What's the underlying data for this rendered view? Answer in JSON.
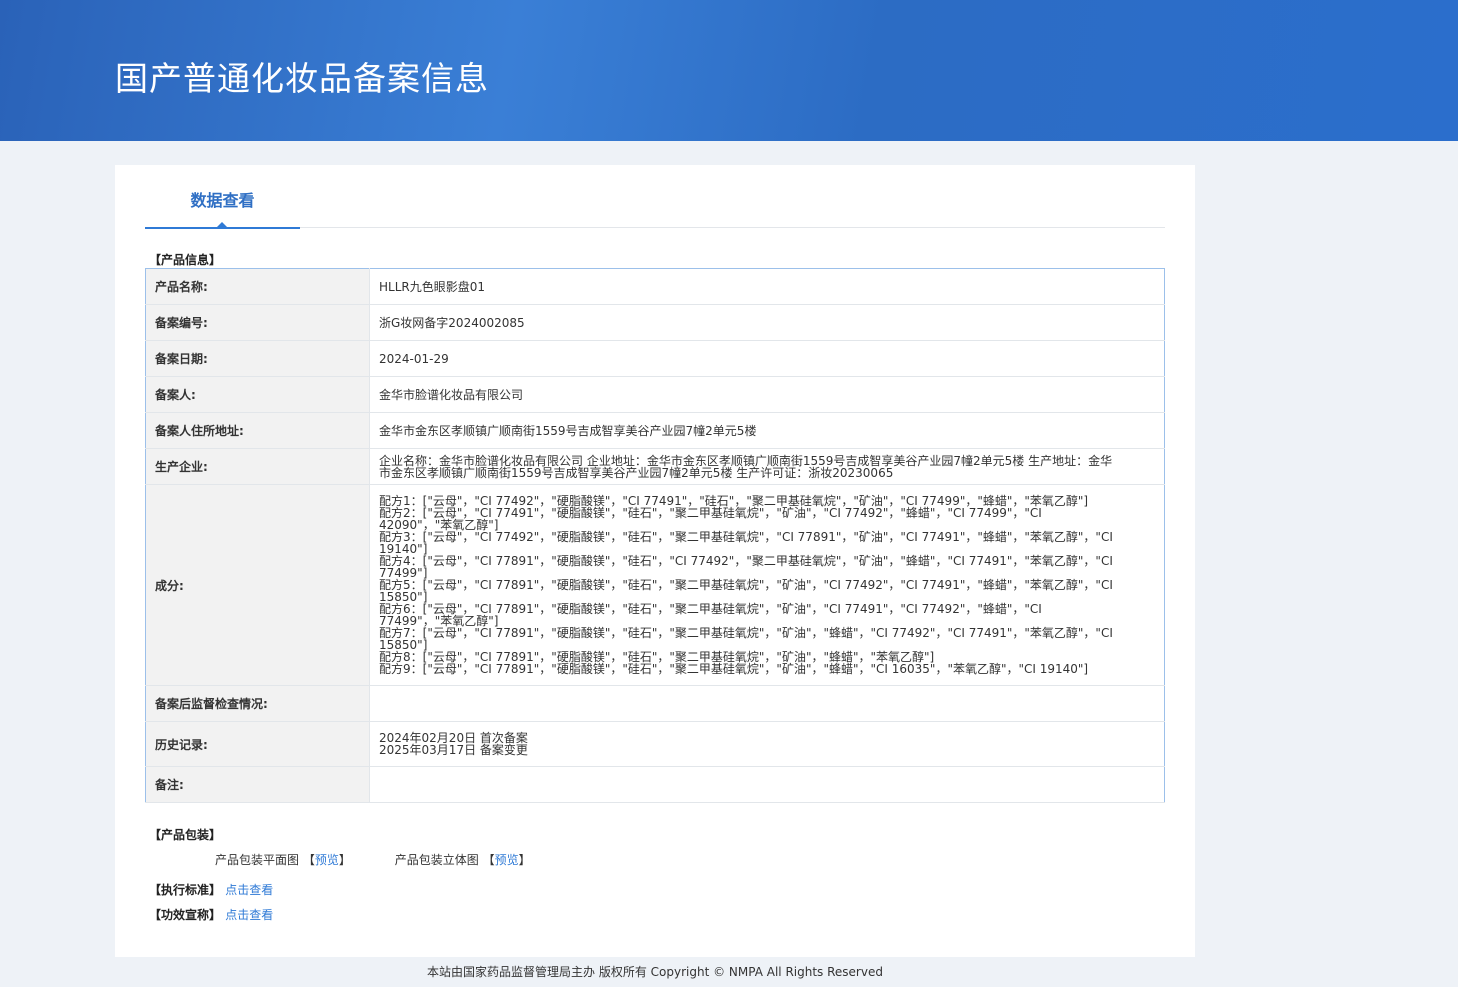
{
  "header": {
    "title": "国产普通化妆品备案信息"
  },
  "tab": "数据查看",
  "section_product": "【产品信息】",
  "rows": [
    {
      "k": "产品名称:",
      "v": "HLLR九色眼影盘01"
    },
    {
      "k": "备案编号:",
      "v": "浙G妆网备字2024002085"
    },
    {
      "k": "备案日期:",
      "v": "2024-01-29"
    },
    {
      "k": "备案人:",
      "v": "金华市脸谱化妆品有限公司"
    },
    {
      "k": "备案人住所地址:",
      "v": "金华市金东区孝顺镇广顺南街1559号吉成智享美谷产业园7幢2单元5楼"
    },
    {
      "k": "生产企业:",
      "v": "企业名称：金华市脸谱化妆品有限公司 企业地址：金华市金东区孝顺镇广顺南街1559号吉成智享美谷产业园7幢2单元5楼 生产地址：金华市金东区孝顺镇广顺南街1559号吉成智享美谷产业园7幢2单元5楼 生产许可证：浙妆20230065"
    }
  ],
  "ingredients": {
    "k": "成分:",
    "lines": [
      "配方1：[\"云母\"，\"CI 77492\"，\"硬脂酸镁\"，\"CI 77491\"，\"硅石\"，\"聚二甲基硅氧烷\"，\"矿油\"，\"CI 77499\"，\"蜂蜡\"，\"苯氧乙醇\"]",
      "配方2：[\"云母\"，\"CI 77491\"，\"硬脂酸镁\"，\"硅石\"，\"聚二甲基硅氧烷\"，\"矿油\"，\"CI 77492\"，\"蜂蜡\"，\"CI 77499\"，\"CI 42090\"，\"苯氧乙醇\"]",
      "配方3：[\"云母\"，\"CI 77492\"，\"硬脂酸镁\"，\"硅石\"，\"聚二甲基硅氧烷\"，\"CI 77891\"，\"矿油\"，\"CI 77491\"，\"蜂蜡\"，\"苯氧乙醇\"，\"CI 19140\"]",
      "配方4：[\"云母\"，\"CI 77891\"，\"硬脂酸镁\"，\"硅石\"，\"CI 77492\"，\"聚二甲基硅氧烷\"，\"矿油\"，\"蜂蜡\"，\"CI 77491\"，\"苯氧乙醇\"，\"CI 77499\"]",
      "配方5：[\"云母\"，\"CI 77891\"，\"硬脂酸镁\"，\"硅石\"，\"聚二甲基硅氧烷\"，\"矿油\"，\"CI 77492\"，\"CI 77491\"，\"蜂蜡\"，\"苯氧乙醇\"，\"CI 15850\"]",
      "配方6：[\"云母\"，\"CI 77891\"，\"硬脂酸镁\"，\"硅石\"，\"聚二甲基硅氧烷\"，\"矿油\"，\"CI 77491\"，\"CI 77492\"，\"蜂蜡\"，\"CI 77499\"，\"苯氧乙醇\"]",
      "配方7：[\"云母\"，\"CI 77891\"，\"硬脂酸镁\"，\"硅石\"，\"聚二甲基硅氧烷\"，\"矿油\"，\"蜂蜡\"，\"CI 77492\"，\"CI 77491\"，\"苯氧乙醇\"，\"CI 15850\"]",
      "配方8：[\"云母\"，\"CI 77891\"，\"硬脂酸镁\"，\"硅石\"，\"聚二甲基硅氧烷\"，\"矿油\"，\"蜂蜡\"，\"苯氧乙醇\"]",
      "配方9：[\"云母\"，\"CI 77891\"，\"硬脂酸镁\"，\"硅石\"，\"聚二甲基硅氧烷\"，\"矿油\"，\"蜂蜡\"，\"CI 16035\"，\"苯氧乙醇\"，\"CI 19140\"]"
    ]
  },
  "inspection": {
    "k": "备案后监督检查情况:",
    "v": ""
  },
  "history": {
    "k": "历史记录:",
    "lines": [
      "2024年02月20日 首次备案",
      "2025年03月17日 备案变更"
    ]
  },
  "remark": {
    "k": "备注:",
    "v": ""
  },
  "packaging": {
    "title": "【产品包装】",
    "flat": "产品包装平面图",
    "solid": "产品包装立体图",
    "preview": "预览",
    "lb": "【",
    "rb": "】"
  },
  "standard": {
    "label": "【执行标准】",
    "link": "点击查看"
  },
  "efficacy": {
    "label": "【功效宣称】",
    "link": "点击查看"
  },
  "footer": "本站由国家药品监督管理局主办 版权所有 Copyright © NMPA All Rights Reserved"
}
